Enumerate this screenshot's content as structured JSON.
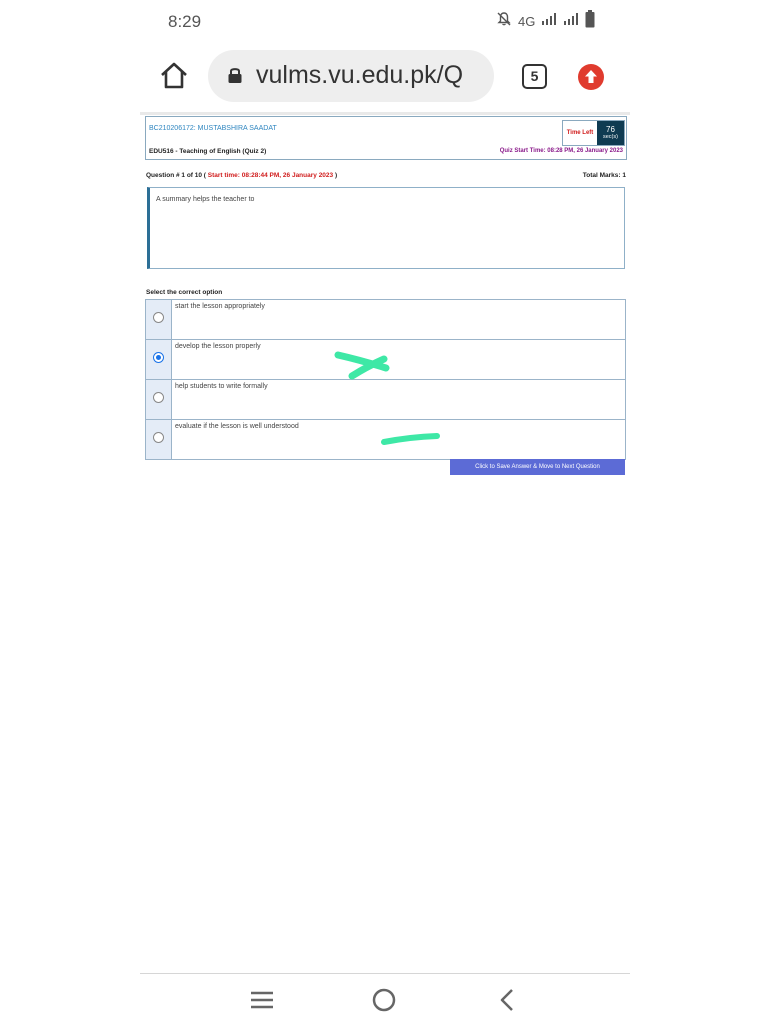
{
  "status_bar": {
    "time": "8:29",
    "network": "4G",
    "icons": [
      "bell-off-icon",
      "signal-icon",
      "signal-icon",
      "battery-icon"
    ]
  },
  "browser": {
    "url": "vulms.vu.edu.pk/Q",
    "tab_count": "5",
    "icons": [
      "home-icon",
      "lock-icon",
      "update-icon"
    ]
  },
  "quiz": {
    "student": "BC210206172: MUSTABSHIRA SAADAT",
    "course": "EDU516 - Teaching of English (Quiz 2)",
    "time_left_label": "Time Left",
    "time_left_value": "76",
    "time_left_unit": "sec(s)",
    "quiz_start": "Quiz Start Time: 08:28 PM, 26 January 2023",
    "question_number": "Question # 1 of 10 (",
    "question_start": "Start time: 08:28:44 PM, 26 January 2023",
    "question_close": ")",
    "total_marks": "Total Marks: 1",
    "question_text": "A summary helps the teacher to",
    "select_label": "Select the correct option",
    "options": [
      {
        "label": "start the lesson appropriately",
        "selected": false
      },
      {
        "label": "develop the lesson properly",
        "selected": true
      },
      {
        "label": "help students to write formally",
        "selected": false
      },
      {
        "label": "evaluate if the lesson is well understood",
        "selected": false
      }
    ],
    "save_button": "Click to Save Answer & Move to Next Question"
  },
  "nav": {
    "icons": [
      "menu-icon",
      "home-circle-icon",
      "back-icon"
    ]
  },
  "colors": {
    "accent": "#5c6bd6",
    "timer_bg": "#0f3b52",
    "alert_red": "#d01c1c",
    "highlight_marker": "#3ee8a6"
  }
}
